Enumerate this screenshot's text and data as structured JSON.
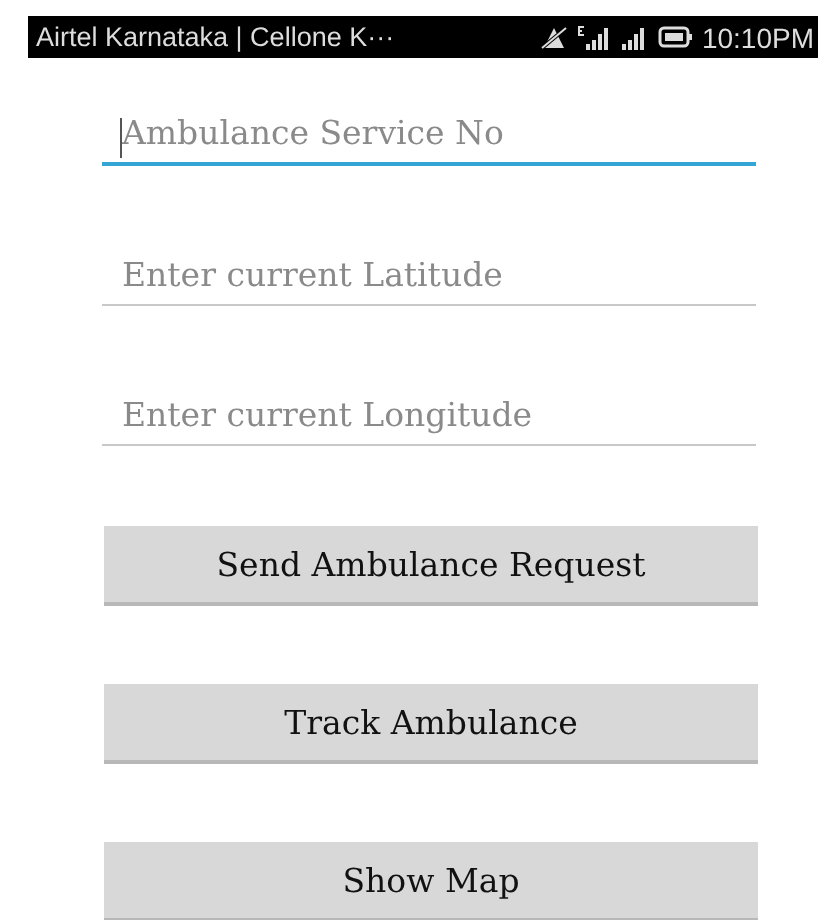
{
  "status_bar": {
    "carrier": "Airtel Karnataka | Cellone K···",
    "time": "10:10PM"
  },
  "fields": [
    {
      "placeholder": "Ambulance Service No",
      "focused": true
    },
    {
      "placeholder": "Enter current Latitude",
      "focused": false
    },
    {
      "placeholder": "Enter current Longitude",
      "focused": false
    }
  ],
  "buttons": [
    "Send Ambulance Request",
    "Track Ambulance",
    "Show Map"
  ]
}
